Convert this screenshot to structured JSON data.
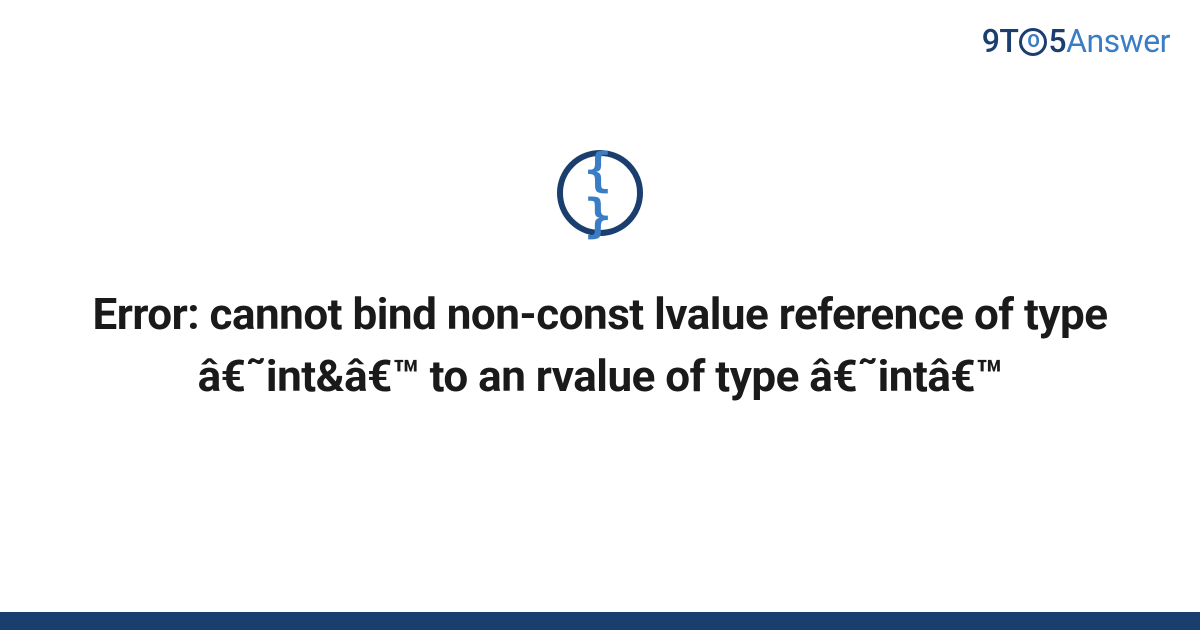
{
  "logo": {
    "part1": "9T",
    "circle": "O",
    "part2": "5",
    "part3": "Answer"
  },
  "icon": {
    "glyph": "{ }",
    "name": "code-braces-icon"
  },
  "title": "Error: cannot bind non-const lvalue reference of type â€˜int&â€™ to an rvalue of type â€˜intâ€™",
  "colors": {
    "dark_blue": "#1a3e6e",
    "light_blue": "#3b7dc4",
    "text": "#1a1a1a",
    "bg": "#ffffff"
  }
}
